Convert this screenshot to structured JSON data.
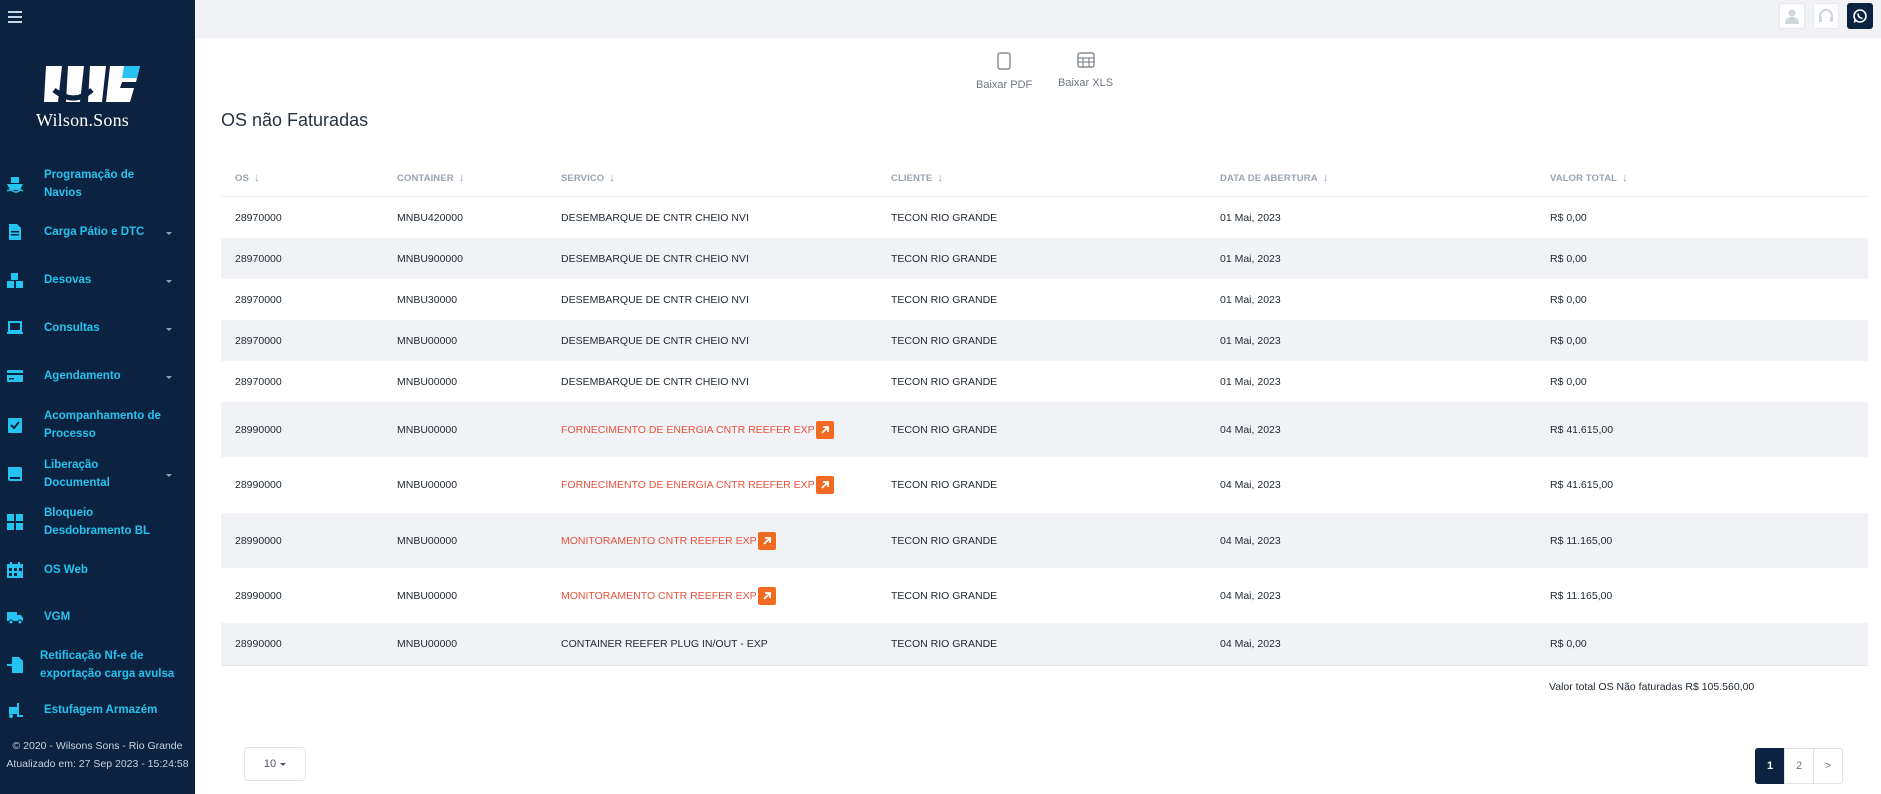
{
  "sidebar": {
    "logo_text": "Wilson.Sons",
    "items": [
      {
        "label": "Programação de Navios",
        "icon": "ship-icon",
        "has_caret": false
      },
      {
        "label": "Carga Pátio e DTC",
        "icon": "document-icon",
        "has_caret": true
      },
      {
        "label": "Desovas",
        "icon": "boxes-icon",
        "has_caret": true
      },
      {
        "label": "Consultas",
        "icon": "laptop-icon",
        "has_caret": true
      },
      {
        "label": "Agendamento",
        "icon": "card-icon",
        "has_caret": true
      },
      {
        "label": "Acompanhamento de Processo",
        "icon": "clipboard-check-icon",
        "has_caret": false
      },
      {
        "label": "Liberação Documental",
        "icon": "book-icon",
        "has_caret": true
      },
      {
        "label": "Bloqueio Desdobramento BL",
        "icon": "grid-icon",
        "has_caret": false
      },
      {
        "label": "OS Web",
        "icon": "calendar-icon",
        "has_caret": false
      },
      {
        "label": "VGM",
        "icon": "truck-icon",
        "has_caret": false
      },
      {
        "label": "Retificação Nf-e de exportação carga avulsa",
        "icon": "file-import-icon",
        "has_caret": false
      },
      {
        "label": "Estufagem Armazém",
        "icon": "forklift-icon",
        "has_caret": false
      }
    ],
    "footer_copyright": "© 2020 - Wilsons Sons - Rio Grande",
    "footer_updated": "Atualizado em: 27 Sep 2023 - 15:24:58"
  },
  "topbar": {
    "buttons": [
      "user-icon",
      "headset-icon",
      "whatsapp-icon"
    ]
  },
  "downloads": {
    "pdf_label": "Baixar PDF",
    "xls_label": "Baixar XLS"
  },
  "page_title": "OS não Faturadas",
  "table": {
    "columns": [
      "OS",
      "CONTAINER",
      "SERVICO",
      "CLIENTE",
      "DATA DE ABERTURA",
      "VALOR TOTAL"
    ],
    "rows": [
      {
        "os": "28970000",
        "container": "MNBU420000",
        "servico": "DESEMBARQUE DE CNTR CHEIO NVI",
        "link": false,
        "cliente": "TECON RIO GRANDE",
        "data": "01 Mai, 2023",
        "valor": "R$ 0,00"
      },
      {
        "os": "28970000",
        "container": "MNBU900000",
        "servico": "DESEMBARQUE DE CNTR CHEIO NVI",
        "link": false,
        "cliente": "TECON RIO GRANDE",
        "data": "01 Mai, 2023",
        "valor": "R$ 0,00"
      },
      {
        "os": "28970000",
        "container": "MNBU30000",
        "servico": "DESEMBARQUE DE CNTR CHEIO NVI",
        "link": false,
        "cliente": "TECON RIO GRANDE",
        "data": "01 Mai, 2023",
        "valor": "R$ 0,00"
      },
      {
        "os": "28970000",
        "container": "MNBU00000",
        "servico": "DESEMBARQUE DE CNTR CHEIO NVI",
        "link": false,
        "cliente": "TECON RIO GRANDE",
        "data": "01 Mai, 2023",
        "valor": "R$ 0,00"
      },
      {
        "os": "28970000",
        "container": "MNBU00000",
        "servico": "DESEMBARQUE DE CNTR CHEIO NVI",
        "link": false,
        "cliente": "TECON RIO GRANDE",
        "data": "01 Mai, 2023",
        "valor": "R$ 0,00"
      },
      {
        "os": "28990000",
        "container": "MNBU00000",
        "servico": "FORNECIMENTO DE ENERGIA CNTR REEFER EXP",
        "link": true,
        "cliente": "TECON RIO GRANDE",
        "data": "04 Mai, 2023",
        "valor": "R$ 41.615,00"
      },
      {
        "os": "28990000",
        "container": "MNBU00000",
        "servico": "FORNECIMENTO DE ENERGIA CNTR REEFER EXP",
        "link": true,
        "cliente": "TECON RIO GRANDE",
        "data": "04 Mai, 2023",
        "valor": "R$ 41.615,00"
      },
      {
        "os": "28990000",
        "container": "MNBU00000",
        "servico": "MONITORAMENTO CNTR REEFER EXP",
        "link": true,
        "cliente": "TECON RIO GRANDE",
        "data": "04 Mai, 2023",
        "valor": "R$ 11.165,00"
      },
      {
        "os": "28990000",
        "container": "MNBU00000",
        "servico": "MONITORAMENTO CNTR REEFER EXP",
        "link": true,
        "cliente": "TECON RIO GRANDE",
        "data": "04 Mai, 2023",
        "valor": "R$ 11.165,00"
      },
      {
        "os": "28990000",
        "container": "MNBU00000",
        "servico": "CONTAINER REEFER PLUG IN/OUT - EXP",
        "link": false,
        "cliente": "TECON RIO GRANDE",
        "data": "04 Mai, 2023",
        "valor": "R$ 0,00"
      }
    ],
    "total_label": "Valor total OS Não faturadas R$ 105.560,00"
  },
  "pagination": {
    "per_page": "10",
    "pages": [
      "1",
      "2"
    ],
    "current": "1",
    "next_label": ">"
  }
}
